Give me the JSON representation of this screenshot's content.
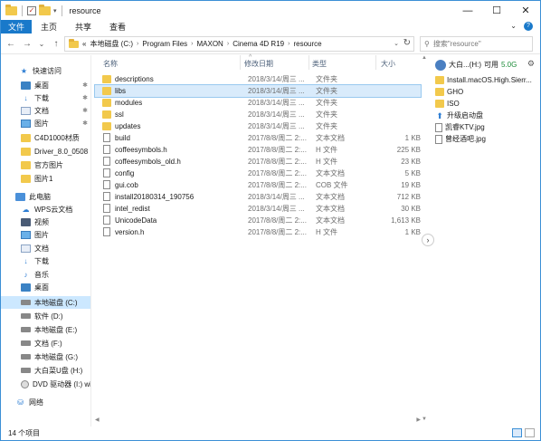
{
  "titlebar": {
    "title": "resource",
    "controls": {
      "minimize": "—",
      "maximize": "☐",
      "close": "✕"
    }
  },
  "ribbon": {
    "file_tab": "文件",
    "tabs": [
      "主页",
      "共享",
      "查看"
    ]
  },
  "nav": {
    "back": "←",
    "forward": "→",
    "recent": "⌄",
    "up": "↑"
  },
  "address": {
    "overflow": "«",
    "crumbs": [
      "本地磁盘 (C:)",
      "Program Files",
      "MAXON",
      "Cinema 4D R19",
      "resource"
    ],
    "separator": "›"
  },
  "search": {
    "placeholder": "搜索\"resource\""
  },
  "sidebar": {
    "items": [
      {
        "label": "快速访问",
        "icon": "star-icon"
      },
      {
        "label": "桌面",
        "icon": "desktop-icon",
        "pinned": true
      },
      {
        "label": "下载",
        "icon": "download-icon",
        "pinned": true
      },
      {
        "label": "文档",
        "icon": "document-icon",
        "pinned": true
      },
      {
        "label": "图片",
        "icon": "picture-icon",
        "pinned": true
      },
      {
        "label": "C4D1000材质",
        "icon": "folder-icon"
      },
      {
        "label": "Driver_8.0_0508",
        "icon": "folder-icon"
      },
      {
        "label": "官方图片",
        "icon": "folder-icon"
      },
      {
        "label": "图片1",
        "icon": "folder-icon"
      },
      {
        "label": "此电脑",
        "icon": "pc-icon"
      },
      {
        "label": "WPS云文档",
        "icon": "cloud-icon"
      },
      {
        "label": "视频",
        "icon": "video-icon"
      },
      {
        "label": "图片",
        "icon": "picture-icon"
      },
      {
        "label": "文档",
        "icon": "document-icon"
      },
      {
        "label": "下载",
        "icon": "download-icon"
      },
      {
        "label": "音乐",
        "icon": "music-icon"
      },
      {
        "label": "桌面",
        "icon": "desktop-icon"
      },
      {
        "label": "本地磁盘 (C:)",
        "icon": "drive-icon",
        "selected": true
      },
      {
        "label": "软件 (D:)",
        "icon": "drive-icon"
      },
      {
        "label": "本地磁盘 (E:)",
        "icon": "drive-icon"
      },
      {
        "label": "文档 (F:)",
        "icon": "drive-icon"
      },
      {
        "label": "本地磁盘 (G:)",
        "icon": "drive-icon"
      },
      {
        "label": "大白菜U盘 (H:)",
        "icon": "drive-icon"
      },
      {
        "label": "DVD 驱动器 (I:) wi",
        "icon": "dvd-icon"
      },
      {
        "label": "网络",
        "icon": "network-icon"
      }
    ],
    "pin_glyph": "✱"
  },
  "columns": {
    "name": "名称",
    "date": "修改日期",
    "type": "类型",
    "size": "大小",
    "sort_glyph": "^"
  },
  "files": [
    {
      "name": "descriptions",
      "date": "2018/3/14/周三 ...",
      "type": "文件夹",
      "size": "",
      "kind": "dir"
    },
    {
      "name": "libs",
      "date": "2018/3/14/周三 ...",
      "type": "文件夹",
      "size": "",
      "kind": "dir",
      "selected": true
    },
    {
      "name": "modules",
      "date": "2018/3/14/周三 ...",
      "type": "文件夹",
      "size": "",
      "kind": "dir"
    },
    {
      "name": "ssl",
      "date": "2018/3/14/周三 ...",
      "type": "文件夹",
      "size": "",
      "kind": "dir"
    },
    {
      "name": "updates",
      "date": "2018/3/14/周三 ...",
      "type": "文件夹",
      "size": "",
      "kind": "dir"
    },
    {
      "name": "build",
      "date": "2017/8/8/周二 2:...",
      "type": "文本文档",
      "size": "1 KB",
      "kind": "file"
    },
    {
      "name": "coffeesymbols.h",
      "date": "2017/8/8/周二 2:...",
      "type": "H 文件",
      "size": "225 KB",
      "kind": "file"
    },
    {
      "name": "coffeesymbols_old.h",
      "date": "2017/8/8/周二 2:...",
      "type": "H 文件",
      "size": "23 KB",
      "kind": "file"
    },
    {
      "name": "config",
      "date": "2017/8/8/周二 2:...",
      "type": "文本文档",
      "size": "5 KB",
      "kind": "file"
    },
    {
      "name": "gui.cob",
      "date": "2017/8/8/周二 2:...",
      "type": "COB 文件",
      "size": "19 KB",
      "kind": "file"
    },
    {
      "name": "install20180314_190756",
      "date": "2018/3/14/周三 ...",
      "type": "文本文档",
      "size": "712 KB",
      "kind": "file"
    },
    {
      "name": "intel_redist",
      "date": "2018/3/14/周三 ...",
      "type": "文本文档",
      "size": "30 KB",
      "kind": "file"
    },
    {
      "name": "UnicodeData",
      "date": "2017/8/8/周二 2:...",
      "type": "文本文档",
      "size": "1,613 KB",
      "kind": "file"
    },
    {
      "name": "version.h",
      "date": "2017/8/8/周二 2:...",
      "type": "H 文件",
      "size": "1 KB",
      "kind": "file"
    }
  ],
  "right_panel": {
    "drive_label": "大白...(H:)",
    "free_label": "可用",
    "free_value": "5.0G",
    "gear": "⚙",
    "items": [
      {
        "label": "Install.macOS.High.Sierr...",
        "kind": "dir"
      },
      {
        "label": "GHO",
        "kind": "dir"
      },
      {
        "label": "ISO",
        "kind": "dir"
      },
      {
        "label": "升级启动盘",
        "kind": "up"
      },
      {
        "label": "凯睿KTV.jpg",
        "kind": "file"
      },
      {
        "label": "曾经酒吧.jpg",
        "kind": "file"
      }
    ],
    "expand_arrow": "›"
  },
  "status": {
    "count": "14 个项目"
  },
  "colors": {
    "accent": "#1979ca",
    "selection": "#cce8ff",
    "folder": "#f2c94c"
  }
}
